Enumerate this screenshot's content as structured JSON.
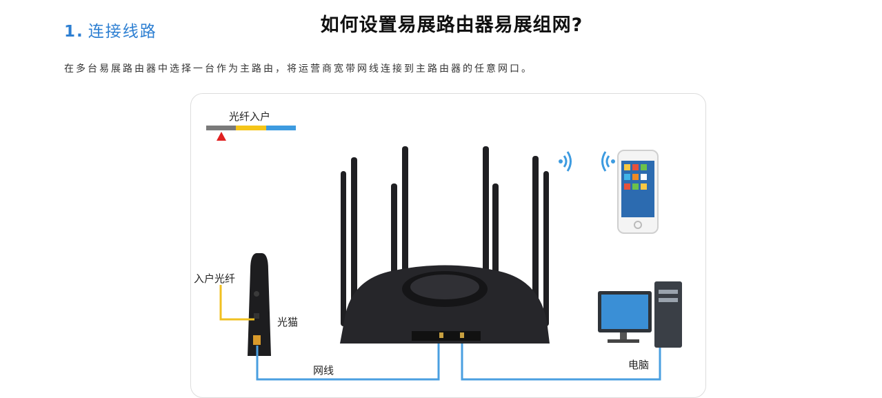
{
  "page_title": "如何设置易展路由器易展组网?",
  "section": {
    "number": "1.",
    "heading": "连接线路",
    "description": "在多台易展路由器中选择一台作为主路由，将运营商宽带网线连接到主路由器的任意网口。"
  },
  "diagram": {
    "legend_label": "光纤入户",
    "fiber_in_label": "入户光纤",
    "modem_label": "光猫",
    "cable_label": "网线",
    "computer_label": "电脑",
    "colors": {
      "heading": "#2d7fd2",
      "cable": "#4a9fe0",
      "fiber": "#f0c020",
      "legend_gray": "#7a7a7a",
      "legend_yellow": "#f5c518",
      "legend_blue": "#3d9be0",
      "legend_marker": "#e02020"
    }
  }
}
